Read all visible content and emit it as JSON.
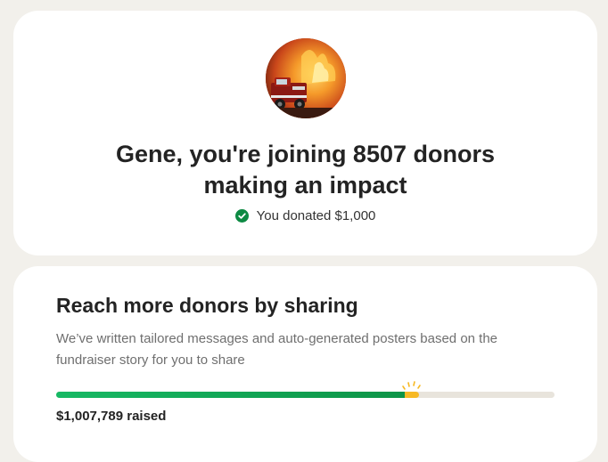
{
  "confirmation": {
    "avatar_icon": "fire-truck-photo",
    "headline_line1": "Gene, you're joining 8507 donors",
    "headline_line2": "making an impact",
    "donated_text": "You donated $1,000",
    "check_color": "#0d8a43"
  },
  "share": {
    "title": "Reach more donors by sharing",
    "description": "We’ve written tailored messages and auto-generated posters based on the fundraiser story for you to share",
    "progress_fraction": 0.7,
    "raised_text": "$1,007,789 raised",
    "progress_color": "#0d9447",
    "spark_color": "#f7b924"
  }
}
